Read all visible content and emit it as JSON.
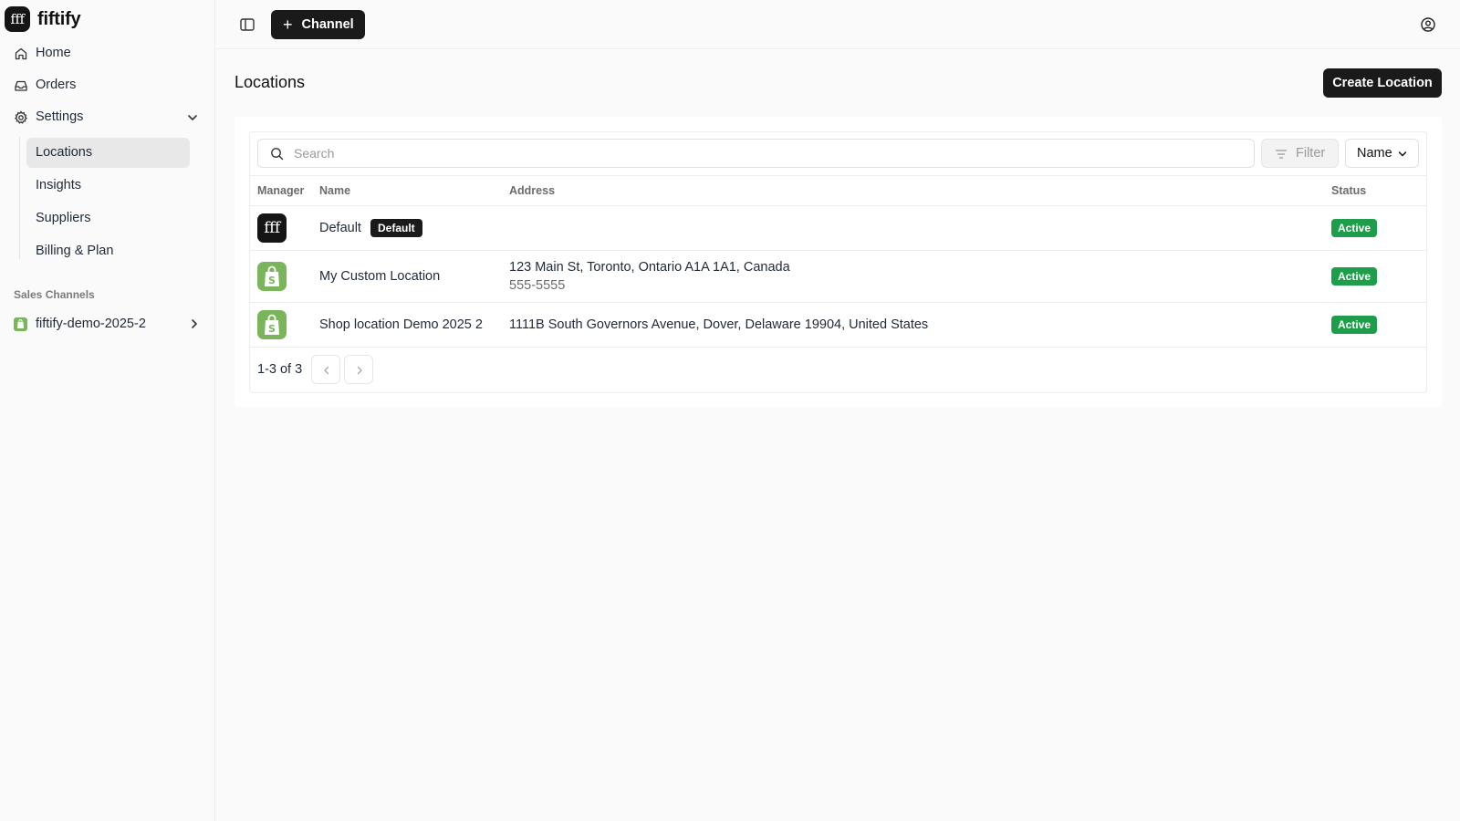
{
  "brand": {
    "logo_text": "fff",
    "name": "fiftify"
  },
  "sidebar": {
    "items": [
      {
        "label": "Home",
        "icon": "home-icon"
      },
      {
        "label": "Orders",
        "icon": "inbox-icon"
      },
      {
        "label": "Settings",
        "icon": "gear-icon",
        "expanded": true
      }
    ],
    "settings_sub": [
      {
        "label": "Locations",
        "active": true
      },
      {
        "label": "Insights",
        "active": false
      },
      {
        "label": "Suppliers",
        "active": false
      },
      {
        "label": "Billing & Plan",
        "active": false
      }
    ],
    "sales_channels_label": "Sales Channels",
    "channels": [
      {
        "label": "fiftify-demo-2025-2",
        "icon": "shopify-icon"
      }
    ]
  },
  "topbar": {
    "channel_button": "Channel"
  },
  "main": {
    "title": "Locations",
    "create_button": "Create Location",
    "search_placeholder": "Search",
    "filter_label": "Filter",
    "sort_label": "Name",
    "columns": {
      "manager": "Manager",
      "name": "Name",
      "address": "Address",
      "status": "Status"
    },
    "rows": [
      {
        "manager": "fiftify",
        "manager_text": "fff",
        "name": "Default",
        "tag": "Default",
        "address": "",
        "phone": "",
        "status": "Active"
      },
      {
        "manager": "shopify",
        "name": "My Custom Location",
        "tag": "",
        "address": "123 Main St, Toronto, Ontario A1A 1A1, Canada",
        "phone": "555-5555",
        "status": "Active"
      },
      {
        "manager": "shopify",
        "name": "Shop location Demo 2025 2",
        "tag": "",
        "address": "1111B South Governors Avenue, Dover, Delaware 19904, United States",
        "phone": "",
        "status": "Active"
      }
    ],
    "pagination": "1-3 of 3"
  },
  "colors": {
    "accent_dark": "#1a1a1a",
    "status_active": "#1e9e4a",
    "shopify_green": "#7ab55c"
  }
}
